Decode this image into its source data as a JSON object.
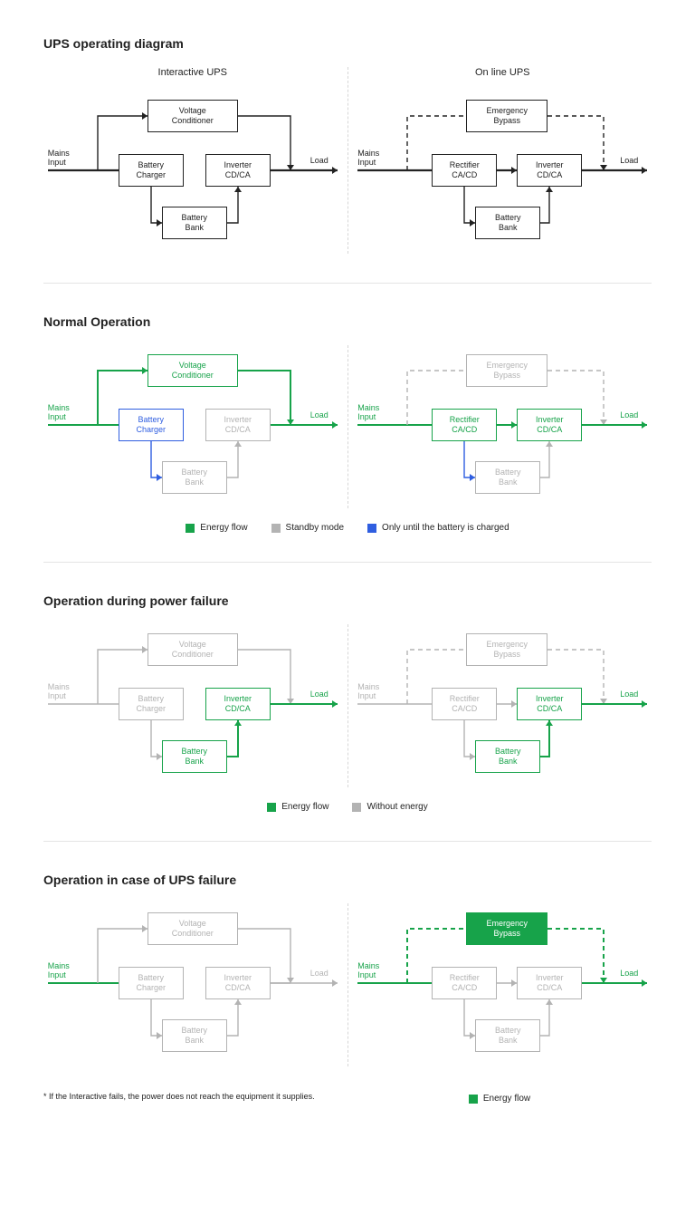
{
  "colors": {
    "black": "#222",
    "green": "#17a34a",
    "gray": "#b3b3b3",
    "blue": "#2f5ee0"
  },
  "titles": {
    "section1": "UPS operating diagram",
    "section2": "Normal Operation",
    "section3": "Operation during power failure",
    "section4": "Operation in case of UPS failure"
  },
  "subtitles": {
    "interactive": "Interactive UPS",
    "online": "On line UPS"
  },
  "boxes": {
    "voltage": "Voltage\nConditioner",
    "charger": "Battery\nCharger",
    "inverterCDCA": "Inverter\nCD/CA",
    "bank": "Battery\nBank",
    "bypass": "Emergency\nBypass",
    "rectifier": "Rectifier\nCA/CD"
  },
  "labels": {
    "mains": "Mains\nInput",
    "load": "Load"
  },
  "legend": {
    "flow": "Energy flow",
    "standby": "Standby mode",
    "charged": "Only until the battery is charged",
    "without": "Without energy"
  },
  "footnote": "*  If the Interactive fails, the power does not reach the equipment it supplies."
}
